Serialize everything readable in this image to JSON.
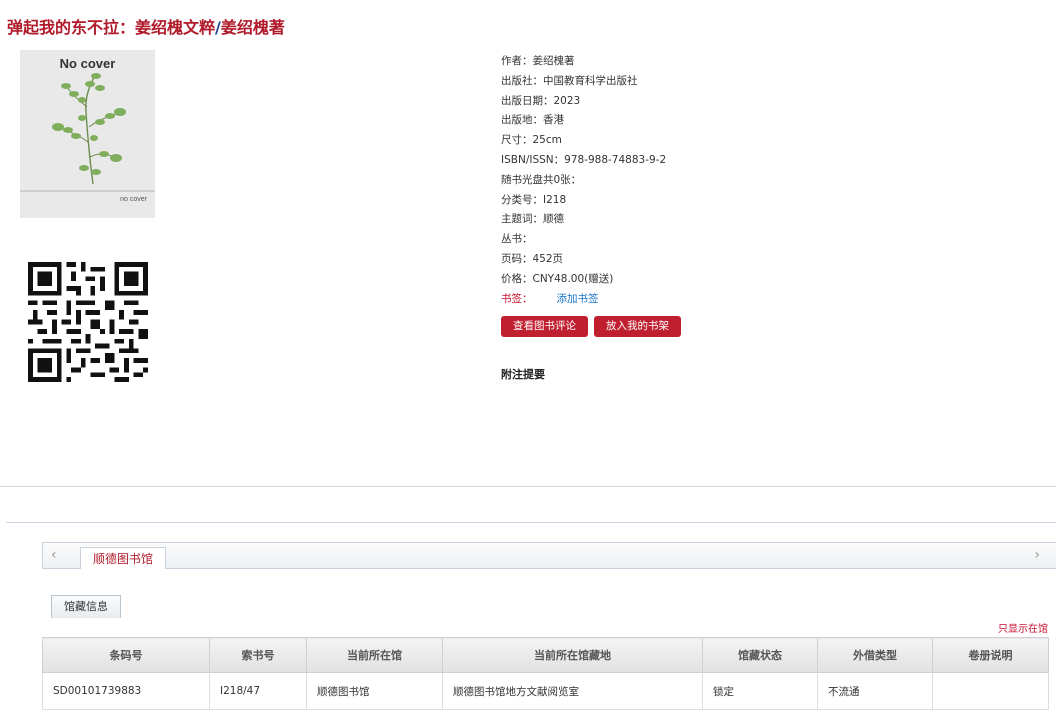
{
  "title": {
    "main": "弹起我的东不拉：姜绍槐文粹",
    "separator": "/",
    "author": "姜绍槐著"
  },
  "cover": {
    "heading": "No cover",
    "footer": "no cover"
  },
  "qr_icon": "qr-code-icon",
  "meta": {
    "rows": [
      {
        "label": "作者：",
        "value": "姜绍槐著"
      },
      {
        "label": "出版社：",
        "value": "中国教育科学出版社"
      },
      {
        "label": "出版日期：",
        "value": "2023"
      },
      {
        "label": "出版地：",
        "value": "香港"
      },
      {
        "label": "尺寸：",
        "value": "25cm"
      },
      {
        "label": "ISBN/ISSN：",
        "value": "978-988-74883-9-2"
      },
      {
        "label": "随书光盘共0张：",
        "value": ""
      },
      {
        "label": "分类号：",
        "value": "I218"
      },
      {
        "label": "主题词：",
        "value": "顺德"
      },
      {
        "label": "丛书：",
        "value": ""
      },
      {
        "label": "页码：",
        "value": "452页"
      },
      {
        "label": "价格：",
        "value": "CNY48.00(赠送)"
      }
    ],
    "bookmark_label": "书签：",
    "bookmark_link": "添加书签"
  },
  "buttons": {
    "review": "查看图书评论",
    "shelf": "放入我的书架"
  },
  "note_heading": "附注提要",
  "tabs": {
    "left_arrow": "‹",
    "right_arrow": "›",
    "library": "顺德图书馆"
  },
  "subtab": "馆藏信息",
  "only_show": "只显示在馆",
  "table": {
    "headers": [
      "条码号",
      "索书号",
      "当前所在馆",
      "当前所在馆藏地",
      "馆藏状态",
      "外借类型",
      "卷册说明"
    ],
    "rows": [
      [
        "SD00101739883",
        "I218/47",
        "顺德图书馆",
        "顺德图书馆地方文献阅览室",
        "锁定",
        "不流通",
        ""
      ]
    ]
  },
  "colors": {
    "title_red": "#b01a2a",
    "button_red": "#c01f2f",
    "link_blue": "#1a73c9",
    "separator_blue": "#1a3f8f"
  }
}
